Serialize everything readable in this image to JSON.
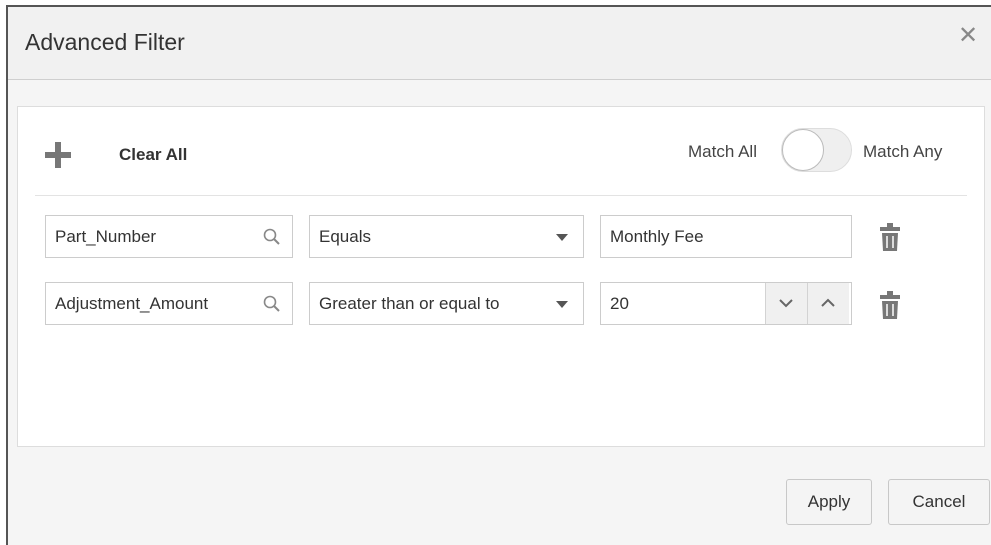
{
  "dialog": {
    "title": "Advanced Filter",
    "close_icon": "close-icon"
  },
  "toolbar": {
    "add_icon": "plus-icon",
    "clear_all_label": "Clear All",
    "match_all_label": "Match All",
    "match_any_label": "Match Any",
    "match_toggle_state": "Match All"
  },
  "rows": [
    {
      "field": "Part_Number",
      "operator": "Equals",
      "value": "Monthly Fee"
    },
    {
      "field": "Adjustment_Amount",
      "operator": "Greater than or equal to",
      "value": "20"
    }
  ],
  "footer": {
    "apply_label": "Apply",
    "cancel_label": "Cancel"
  },
  "colors": {
    "header_bg": "#f1f1f1",
    "panel_bg": "#ffffff",
    "icon_gray": "#777777"
  }
}
